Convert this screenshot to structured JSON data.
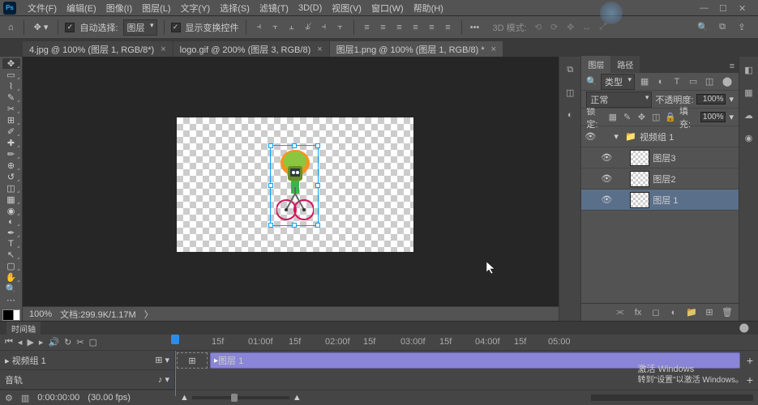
{
  "menu": {
    "file": "文件(F)",
    "edit": "编辑(E)",
    "image": "图像(I)",
    "layer": "图层(L)",
    "type": "文字(Y)",
    "select": "选择(S)",
    "filter": "滤镜(T)",
    "threed": "3D(D)",
    "view": "视图(V)",
    "window": "窗口(W)",
    "help": "帮助(H)"
  },
  "options": {
    "autoselect": "自动选择:",
    "autoselect_target": "图层",
    "show_transform": "显示变换控件",
    "mode3d": "3D 模式:"
  },
  "tabs": [
    {
      "label": "4.jpg @ 100% (图层 1, RGB/8*)"
    },
    {
      "label": "logo.gif @ 200% (图层 3, RGB/8)"
    },
    {
      "label": "图层1.png @ 100% (图层 1, RGB/8) *"
    }
  ],
  "status": {
    "zoom": "100%",
    "docsize": "文档:299.9K/1.17M"
  },
  "panels": {
    "layers": "图层",
    "paths": "路径",
    "kind": "类型",
    "blend": "正常",
    "opacity_label": "不透明度:",
    "opacity_val": "100%",
    "lock_label": "锁定:",
    "fill_label": "填充:",
    "fill_val": "100%"
  },
  "layers": [
    {
      "name": "视频组 1",
      "group": true
    },
    {
      "name": "图层3"
    },
    {
      "name": "图层2"
    },
    {
      "name": "图层 1",
      "selected": true
    }
  ],
  "timeline": {
    "title": "时间轴",
    "track": "视频组 1",
    "clip": "图层 1",
    "audio": "音轨",
    "time": "0:00:00:00",
    "fps": "(30.00 fps)",
    "marks": [
      "15f",
      "01:00f",
      "15f",
      "02:00f",
      "15f",
      "03:00f",
      "15f",
      "04:00f",
      "15f",
      "05:00"
    ]
  },
  "watermark": {
    "line1": "激活 Windows",
    "line2": "转到\"设置\"以激活 Windows。"
  }
}
